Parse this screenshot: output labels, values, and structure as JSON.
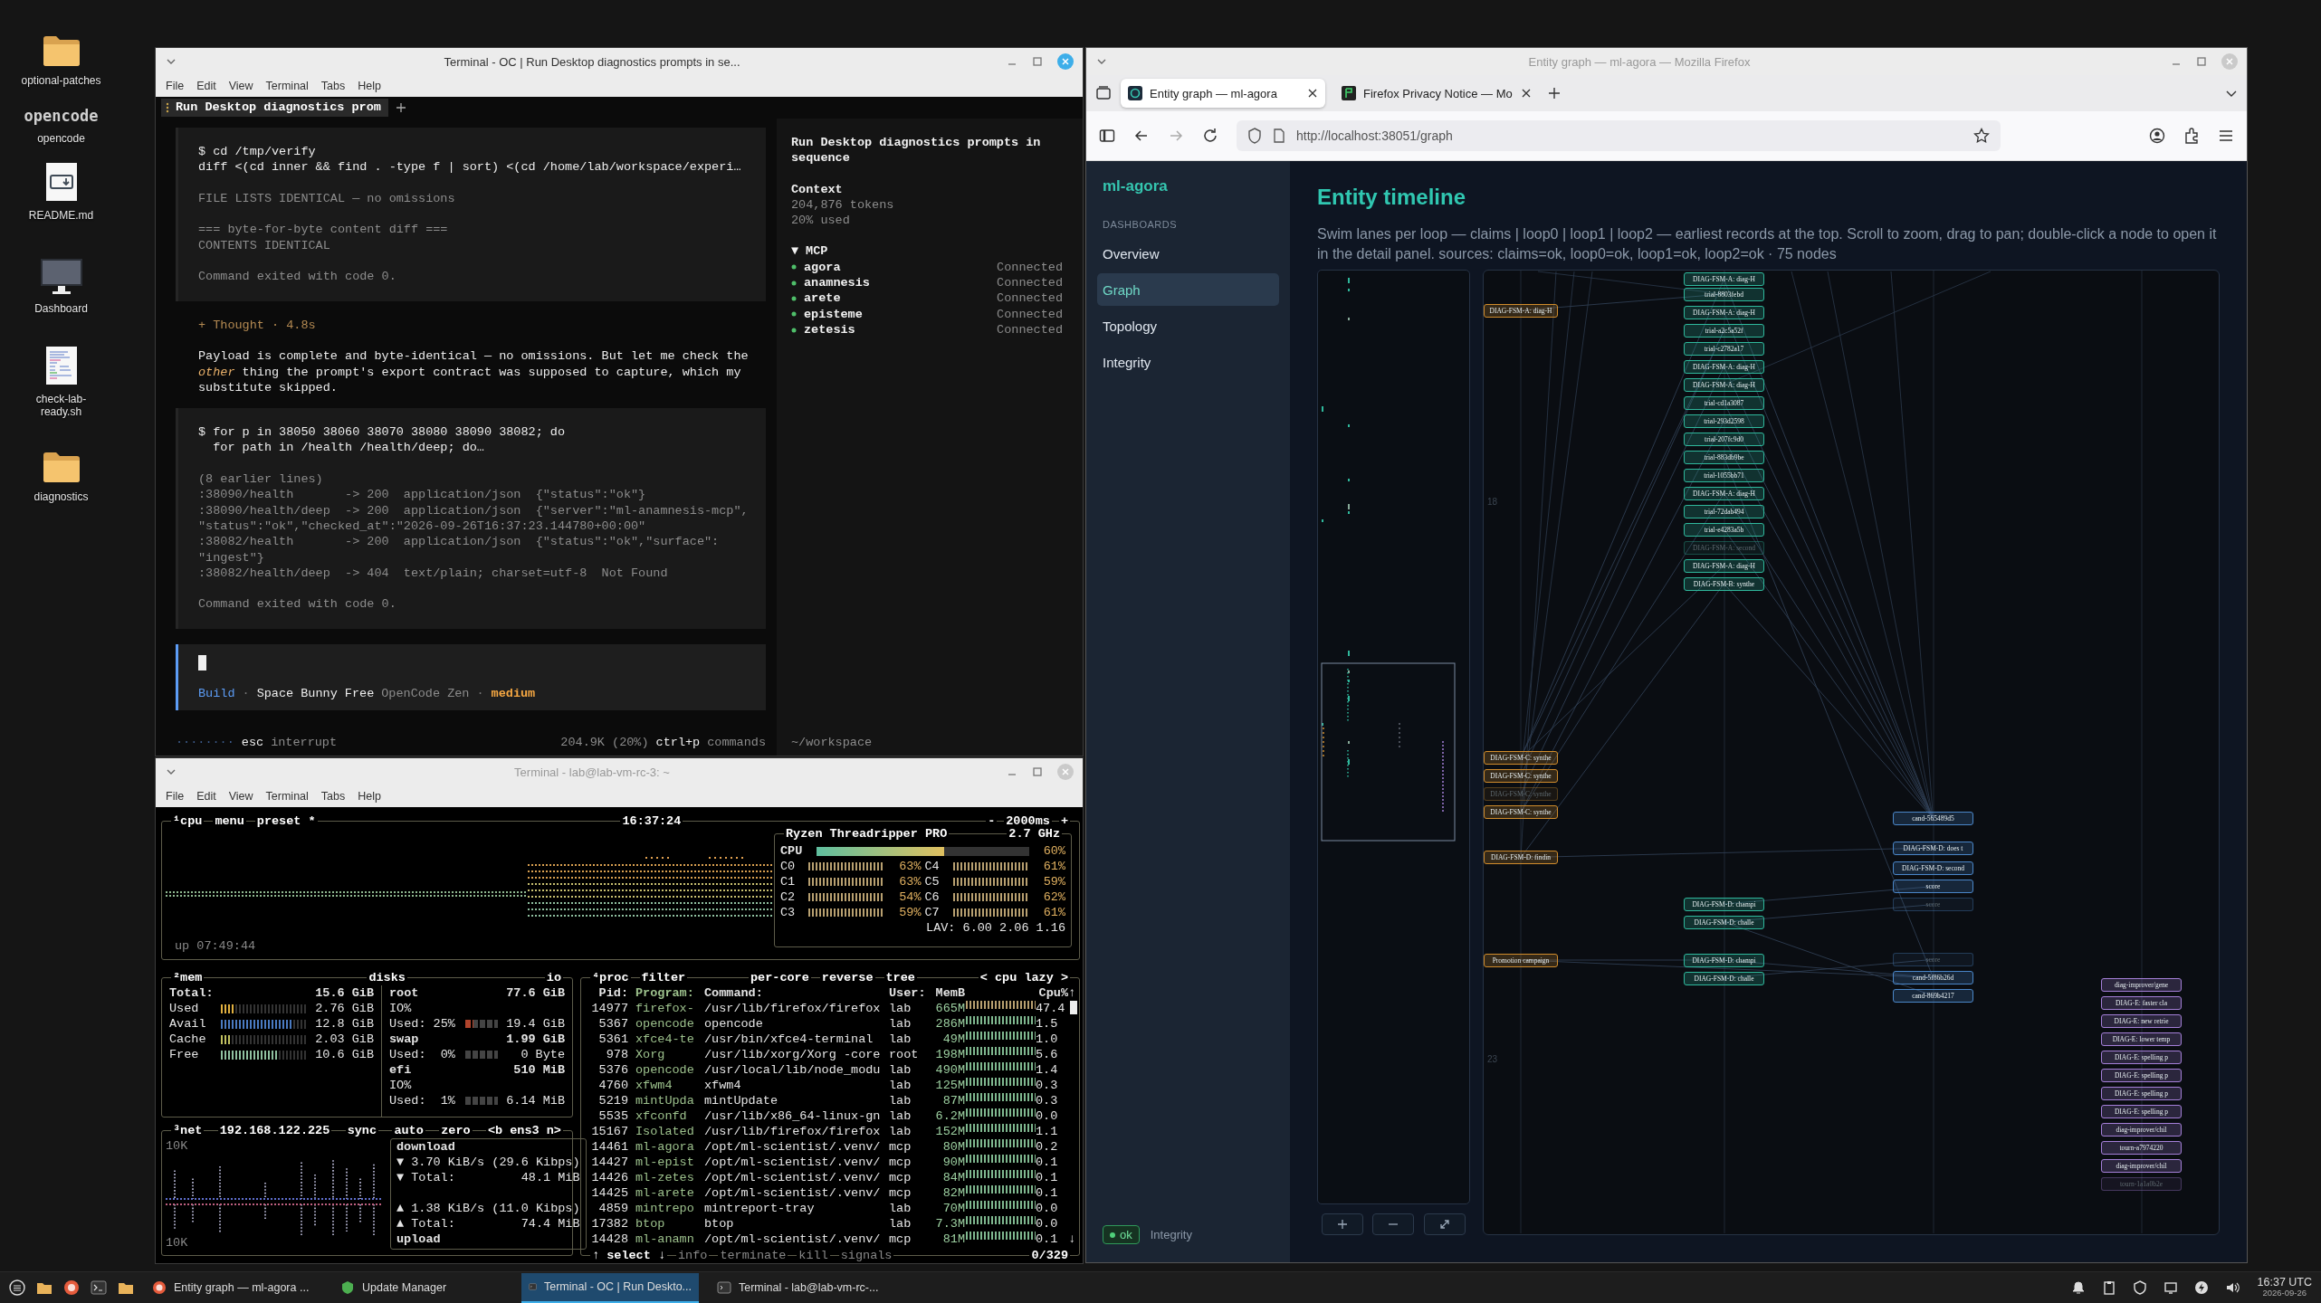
{
  "desktop": {
    "icons": [
      {
        "kind": "folder",
        "label": "optional-patches"
      },
      {
        "kind": "logo",
        "logo": "opencode",
        "label": "opencode"
      },
      {
        "kind": "markdown",
        "label": "README.md"
      },
      {
        "kind": "monitor",
        "label": "Dashboard"
      },
      {
        "kind": "script",
        "label": "check-lab-ready.sh"
      },
      {
        "kind": "folder",
        "label": "diagnostics"
      }
    ]
  },
  "opencode": {
    "title": "Terminal - OC | Run Desktop diagnostics prompts in se...",
    "active": true,
    "menu": [
      "File",
      "Edit",
      "View",
      "Terminal",
      "Tabs",
      "Help"
    ],
    "tab": "Run Desktop diagnostics prom",
    "blocks": [
      {
        "kind": "tool",
        "command": [
          "$ cd /tmp/verify",
          "diff <(cd inner && find . -type f | sort) <(cd /home/lab/workspace/experi…"
        ],
        "output": [
          [
            "FILE LISTS IDENTICAL — no omissions"
          ],
          [
            "=== byte-for-byte content diff ===",
            "CONTENTS IDENTICAL"
          ],
          [
            "Command exited with code 0."
          ]
        ]
      },
      {
        "kind": "thought",
        "title": "+ Thought · 4.8s",
        "text": "Payload is complete and byte-identical — no omissions. But let me check the *other* thing the prompt's export contract was supposed to capture, which my substitute skipped."
      },
      {
        "kind": "tool",
        "command": [
          "$ for p in 38050 38060 38070 38080 38090 38082; do",
          "  for path in /health /health/deep; do…"
        ],
        "output": [
          [
            "(8 earlier lines)",
            ":38090/health       -> 200  application/json  {\"status\":\"ok\"}",
            ":38090/health/deep  -> 200  application/json  {\"server\":\"ml-anamnesis-mcp\",",
            "\"status\":\"ok\",\"checked_at\":\"2026-09-26T16:37:23.144780+00:00\"",
            ":38082/health       -> 200  application/json  {\"status\":\"ok\",\"surface\":",
            "\"ingest\"}",
            ":38082/health/deep  -> 404  text/plain; charset=utf-8  Not Found"
          ],
          [
            "Command exited with code 0."
          ]
        ]
      }
    ],
    "prompt": [
      {
        "kind": "mode",
        "text": "Build"
      },
      {
        "kind": "sep",
        "text": "·"
      },
      {
        "kind": "model",
        "text": "Space Bunny Free"
      },
      {
        "kind": "provider",
        "text": "OpenCode Zen"
      },
      {
        "kind": "sep",
        "text": "·"
      },
      {
        "kind": "effort",
        "text": "medium"
      }
    ],
    "status": {
      "spinner": "········",
      "key": "esc",
      "key_label": "interrupt",
      "usage": "204.9K (20%)",
      "shortcut": "ctrl+p",
      "shortcut_label": "commands"
    },
    "side": {
      "title": "Run Desktop diagnostics prompts in sequence",
      "context_title": "Context",
      "context": [
        "204,876 tokens",
        "20% used"
      ],
      "mcp_toggle": "▼",
      "mcp_title": "MCP",
      "servers": [
        {
          "name": "agora",
          "status": "Connected"
        },
        {
          "name": "anamnesis",
          "status": "Connected"
        },
        {
          "name": "arete",
          "status": "Connected"
        },
        {
          "name": "episteme",
          "status": "Connected"
        },
        {
          "name": "zetesis",
          "status": "Connected"
        }
      ],
      "cwd": "~/workspace"
    }
  },
  "btop": {
    "title": "Terminal - lab@lab-vm-rc-3: ~",
    "active": false,
    "menu": [
      "File",
      "Edit",
      "View",
      "Terminal",
      "Tabs",
      "Help"
    ],
    "cpu": {
      "tabs": [
        "¹cpu",
        "menu",
        "preset *"
      ],
      "clock": "16:37:24",
      "minus": "-",
      "refresh": "2000ms",
      "plus": "+",
      "uptime": "up 07:49:44",
      "model": "Ryzen Threadripper PRO",
      "freq": "2.7 GHz",
      "total": {
        "label": "CPU",
        "value": "60%",
        "level": 0.6
      },
      "cores": [
        {
          "name": "C0",
          "value": "63%"
        },
        {
          "name": "C4",
          "value": "61%"
        },
        {
          "name": "C1",
          "value": "63%"
        },
        {
          "name": "C5",
          "value": "59%"
        },
        {
          "name": "C2",
          "value": "54%"
        },
        {
          "name": "C6",
          "value": "62%"
        },
        {
          "name": "C3",
          "value": "59%"
        },
        {
          "name": "C7",
          "value": "61%"
        }
      ],
      "load": "LAV: 6.00 2.06 1.16"
    },
    "mem": {
      "tab": "²mem",
      "rows": [
        {
          "kind": "total",
          "label": "Total:",
          "value": "15.6 GiB"
        },
        {
          "kind": "meter",
          "label": "Used",
          "value": "2.76 GiB",
          "level": 0.18
        },
        {
          "kind": "meter",
          "label": "Avail",
          "value": "12.8 GiB",
          "level": 0.82
        },
        {
          "kind": "meter",
          "label": "Cache",
          "value": "2.03 GiB",
          "level": 0.13
        },
        {
          "kind": "meter",
          "label": "Free",
          "value": "10.6 GiB",
          "level": 0.68
        }
      ]
    },
    "disks": {
      "tab": "disks",
      "io_tab": "io",
      "items": [
        {
          "name": "root",
          "size": "77.6 GiB",
          "io": "IO%",
          "used_label": "Used: 25%",
          "used": "19.4 GiB",
          "level": 0.25
        },
        {
          "name": "swap",
          "size": "1.99 GiB",
          "used_label": "Used:  0%",
          "used": "0 Byte",
          "level": 0
        },
        {
          "name": "efi",
          "size": "510 MiB",
          "io": "IO%",
          "used_label": "Used:  1%",
          "used": "6.14 MiB",
          "level": 0.01
        }
      ]
    },
    "net": {
      "tabs": [
        "³net",
        "192.168.122.225",
        "sync",
        "auto",
        "zero",
        "<b ens3 n>"
      ],
      "scale_top": "10K",
      "scale_bottom": "10K",
      "download": "download",
      "down_rate": "▼ 3.70 KiB/s (29.6 Kibps)",
      "down_total_label": "▼ Total:",
      "down_total": "48.1 MiB",
      "up_rate": "▲ 1.38 KiB/s (11.0 Kibps)",
      "up_total_label": "▲ Total:",
      "up_total": "74.4 MiB",
      "upload": "upload"
    },
    "proc": {
      "tabs": [
        "⁴proc",
        "filter",
        "per-core",
        "reverse",
        "tree",
        "< cpu lazy >"
      ],
      "columns": [
        "Pid:",
        "Program:",
        "Command:",
        "User:",
        "MemB",
        "Cpu%"
      ],
      "scroll_up": "↑",
      "scroll_down": "↓",
      "rows": [
        [
          "14977",
          "firefox-",
          "/usr/lib/firefox/firefox",
          "lab",
          "665M",
          "47.4"
        ],
        [
          "5367",
          "opencode",
          "opencode",
          "lab",
          "286M",
          "1.5"
        ],
        [
          "5361",
          "xfce4-te",
          "/usr/bin/xfce4-terminal",
          "lab",
          "49M",
          "1.0"
        ],
        [
          "978",
          "Xorg",
          "/usr/lib/xorg/Xorg -core",
          "root",
          "198M",
          "5.6"
        ],
        [
          "5376",
          "opencode",
          "/usr/local/lib/node_modu",
          "lab",
          "490M",
          "1.4"
        ],
        [
          "4760",
          "xfwm4",
          "xfwm4",
          "lab",
          "125M",
          "0.3"
        ],
        [
          "5219",
          "mintUpda",
          "mintUpdate",
          "lab",
          "87M",
          "0.3"
        ],
        [
          "5535",
          "xfconfd",
          "/usr/lib/x86_64-linux-gn",
          "lab",
          "6.2M",
          "0.0"
        ],
        [
          "15167",
          "Isolated",
          "/usr/lib/firefox/firefox",
          "lab",
          "152M",
          "1.1"
        ],
        [
          "14461",
          "ml-agora",
          "/opt/ml-scientist/.venv/",
          "mcp",
          "80M",
          "0.2"
        ],
        [
          "14427",
          "ml-epist",
          "/opt/ml-scientist/.venv/",
          "mcp",
          "90M",
          "0.1"
        ],
        [
          "14426",
          "ml-zetes",
          "/opt/ml-scientist/.venv/",
          "mcp",
          "84M",
          "0.1"
        ],
        [
          "14425",
          "ml-arete",
          "/opt/ml-scientist/.venv/",
          "mcp",
          "82M",
          "0.1"
        ],
        [
          "4859",
          "mintrepo",
          "mintreport-tray",
          "lab",
          "70M",
          "0.0"
        ],
        [
          "17382",
          "btop",
          "btop",
          "lab",
          "7.3M",
          "0.0"
        ],
        [
          "14428",
          "ml-anamn",
          "/opt/ml-scientist/.venv/",
          "mcp",
          "81M",
          "0.1"
        ]
      ],
      "footer": [
        "↑ select ↓",
        "info",
        "terminate",
        "kill",
        "signals"
      ],
      "count": "0/329"
    }
  },
  "firefox": {
    "title": "Entity graph — ml-agora — Mozilla Firefox",
    "active": false,
    "tabs": [
      {
        "title": "Entity graph — ml-agora",
        "selected": true
      },
      {
        "title": "Firefox Privacy Notice — Mo",
        "selected": false
      }
    ],
    "url": "http://localhost:38051/graph",
    "forward_disabled": true,
    "app": {
      "brand": "ml-agora",
      "section": "DASHBOARDS",
      "nav": [
        {
          "label": "Overview",
          "selected": false
        },
        {
          "label": "Graph",
          "selected": true
        },
        {
          "label": "Topology",
          "selected": false
        },
        {
          "label": "Integrity",
          "selected": false
        }
      ],
      "status_badge": "ok",
      "status_label": "Integrity",
      "heading": "Entity timeline",
      "description": "Swim lanes per loop — claims | loop0 | loop1 | loop2 — earliest records at the top. Scroll to zoom, drag to pan; double-click a node to open it in the detail panel. sources: claims=ok, loop0=ok, loop1=ok, loop2=ok · 75 nodes",
      "time_marks": [
        "18",
        "23"
      ],
      "lanes": [
        {
          "color": "#d08c2c",
          "nodes": [
            {
              "label": "DIAG-FSM-A: diag-H",
              "faded": false
            },
            {
              "label": "DIAG-FSM-C: synthe",
              "faded": false
            },
            {
              "label": "DIAG-FSM-C: synthe",
              "faded": false
            },
            {
              "label": "DIAG-FSM-C: synthe",
              "faded": true
            },
            {
              "label": "DIAG-FSM-C: synthe",
              "faded": false
            },
            {
              "label": "DIAG-FSM-D: findin",
              "faded": false
            },
            {
              "label": "Promotion campaign",
              "faded": false
            }
          ]
        },
        {
          "color": "#2fb89c",
          "nodes": [
            {
              "label": "DIAG-FSM-A: diag-H",
              "faded": false
            },
            {
              "label": "trial-8803febd",
              "faded": false
            },
            {
              "label": "DIAG-FSM-A: diag-H",
              "faded": false
            },
            {
              "label": "trial-a2c5a52f",
              "faded": false
            },
            {
              "label": "trial-c2782a17",
              "faded": false
            },
            {
              "label": "DIAG-FSM-A: diag-H",
              "faded": false
            },
            {
              "label": "DIAG-FSM-A: diag-H",
              "faded": false
            },
            {
              "label": "trial-cd1a3087",
              "faded": false
            },
            {
              "label": "trial-293d2598",
              "faded": false
            },
            {
              "label": "trial-207fc9d0",
              "faded": false
            },
            {
              "label": "trial-883db9be",
              "faded": false
            },
            {
              "label": "trial-1055bb71",
              "faded": false
            },
            {
              "label": "DIAG-FSM-A: diag-H",
              "faded": false
            },
            {
              "label": "trial-72dab494",
              "faded": false
            },
            {
              "label": "trial-e4283a5b",
              "faded": false
            },
            {
              "label": "DIAG-FSM-A: second",
              "faded": true
            },
            {
              "label": "DIAG-FSM-A: diag-H",
              "faded": false
            },
            {
              "label": "DIAG-FSM-B: synthe",
              "faded": false
            },
            {
              "label": "DIAG-FSM-D: champi",
              "faded": false
            },
            {
              "label": "DIAG-FSM-D: challe",
              "faded": false
            },
            {
              "label": "DIAG-FSM-D: champi",
              "faded": false
            },
            {
              "label": "DIAG-FSM-D: challe",
              "faded": false
            }
          ]
        },
        {
          "color": "#4a86c8",
          "nodes": [
            {
              "label": "cand-565489d5",
              "faded": false
            },
            {
              "label": "DIAG-FSM-D: does t",
              "faded": false
            },
            {
              "label": "DIAG-FSM-D: second",
              "faded": false
            },
            {
              "label": "score",
              "faded": false
            },
            {
              "label": "score",
              "faded": true
            },
            {
              "label": "score",
              "faded": true
            },
            {
              "label": "cand-5f86b26d",
              "faded": false
            },
            {
              "label": "cand-869b4217",
              "faded": false
            }
          ]
        },
        {
          "color": "#a47fd8",
          "nodes": [
            {
              "label": "diag-improver/gene",
              "faded": false
            },
            {
              "label": "DIAG-E: faster cla",
              "faded": false
            },
            {
              "label": "DIAG-E: new retrie",
              "faded": false
            },
            {
              "label": "DIAG-E: lower temp",
              "faded": false
            },
            {
              "label": "DIAG-E: spelling p",
              "faded": false
            },
            {
              "label": "DIAG-E: spelling p",
              "faded": false
            },
            {
              "label": "DIAG-E: spelling p",
              "faded": false
            },
            {
              "label": "DIAG-E: spelling p",
              "faded": false
            },
            {
              "label": "diag-improver/chil",
              "faded": false
            },
            {
              "label": "tourn-a7974220",
              "faded": false
            },
            {
              "label": "diag-improver/chil",
              "faded": false
            },
            {
              "label": "tourn-1a1a0b2e",
              "faded": true
            }
          ]
        }
      ]
    }
  },
  "taskbar": {
    "tasks": [
      {
        "label": "Entity graph — ml-agora ...",
        "selected": false
      },
      {
        "label": "Update Manager",
        "selected": false
      },
      {
        "label": "Terminal - OC | Run Deskto...",
        "selected": true
      },
      {
        "label": "Terminal - lab@lab-vm-rc-...",
        "selected": false
      }
    ],
    "time": "16:37 UTC",
    "date": "2026-09-26"
  }
}
